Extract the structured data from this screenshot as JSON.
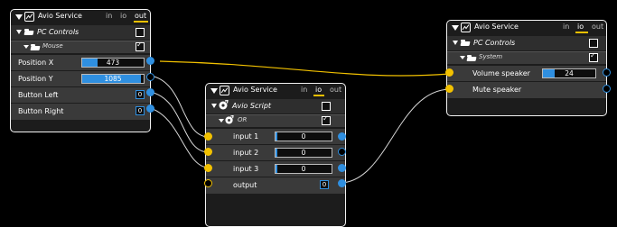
{
  "colors": {
    "accent": "#f2c100",
    "port_blue": "#2f8fe0",
    "node_border": "#f2f2f2"
  },
  "node_left": {
    "title": "Avio Service",
    "tabs": [
      "in",
      "io",
      "out"
    ],
    "active_tab": "out",
    "section": {
      "label": "PC Controls",
      "checked": false
    },
    "subsection": {
      "label": "Mouse",
      "checked": true
    },
    "rows": [
      {
        "label": "Position X",
        "value": "473",
        "fill": 0.25
      },
      {
        "label": "Position Y",
        "value": "1085",
        "fill": 0.95
      },
      {
        "label": "Button Left",
        "value": "0"
      },
      {
        "label": "Button Right",
        "value": "0"
      }
    ]
  },
  "node_mid": {
    "title": "Avio Service",
    "tabs": [
      "in",
      "io",
      "out"
    ],
    "active_tab": "io",
    "section": {
      "label": "Avio Script",
      "checked": false
    },
    "subsection": {
      "label": "OR",
      "checked": true
    },
    "rows": [
      {
        "label": "input 1",
        "value": "0"
      },
      {
        "label": "input 2",
        "value": "0"
      },
      {
        "label": "input 3",
        "value": "0"
      },
      {
        "label": "output",
        "value": "0"
      }
    ]
  },
  "node_right": {
    "title": "Avio Service",
    "tabs": [
      "in",
      "io",
      "out"
    ],
    "active_tab": "io",
    "section": {
      "label": "PC Controls",
      "checked": false
    },
    "subsection": {
      "label": "System",
      "checked": true
    },
    "rows": [
      {
        "label": "Volume speaker",
        "value": "24",
        "fill": 0.22
      },
      {
        "label": "Mute speaker"
      }
    ]
  },
  "icons": {
    "app": "gauge-icon",
    "folder": "folder-icon",
    "or": "gear-icon"
  }
}
